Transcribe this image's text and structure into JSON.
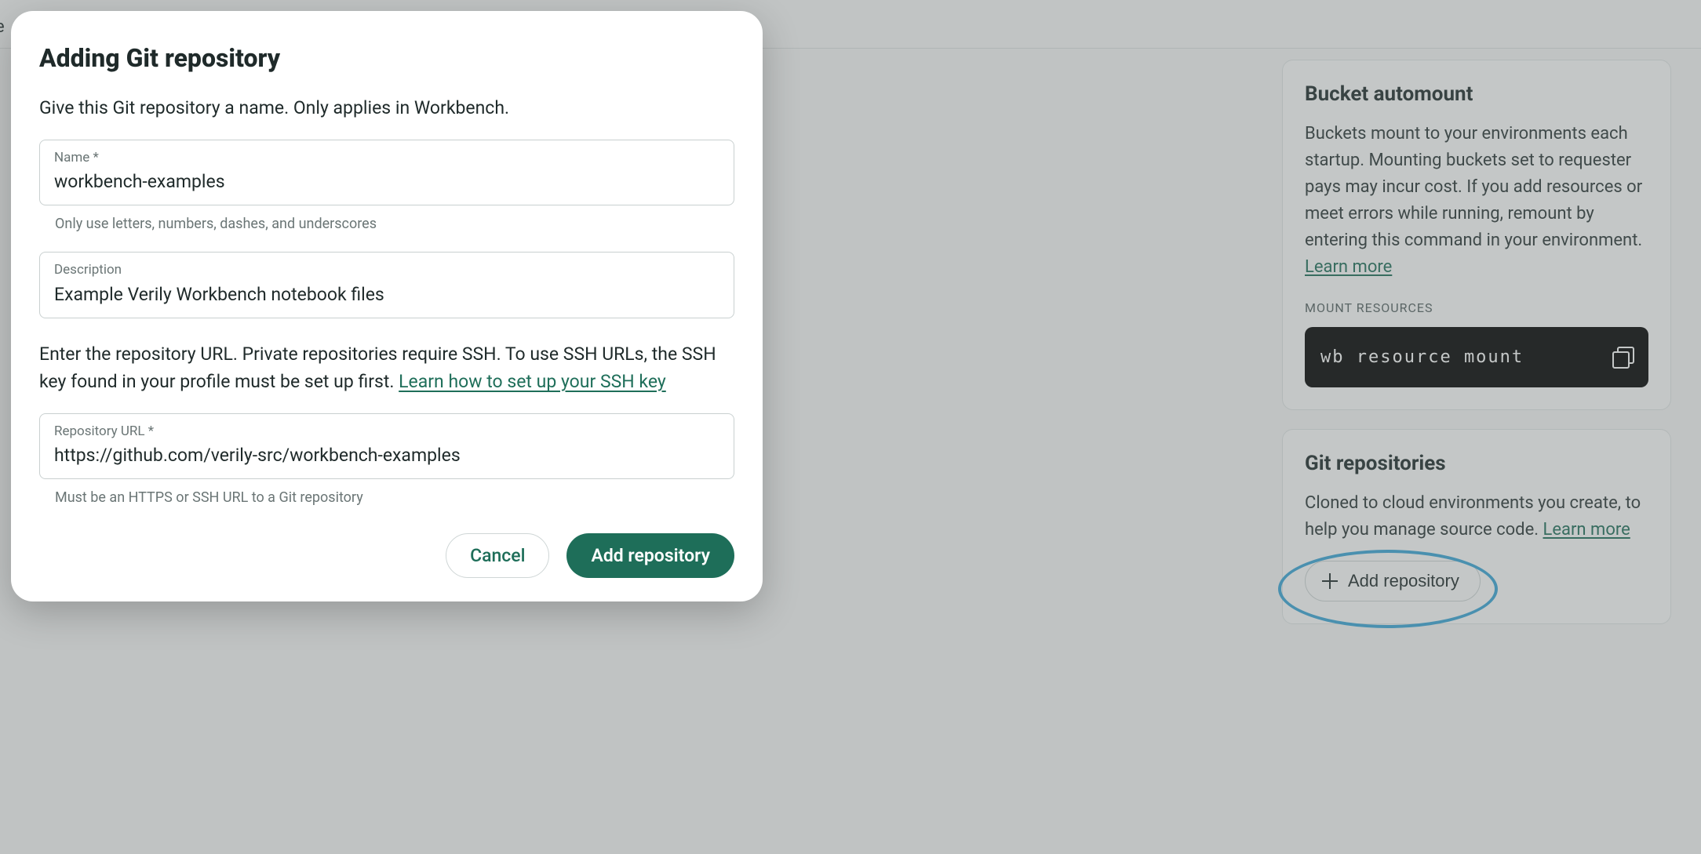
{
  "header": {
    "partial_text": "e"
  },
  "sidebar": {
    "bucket": {
      "title": "Bucket automount",
      "body": "Buckets mount to your environments each startup. Mounting buckets set to requester pays may incur cost. If you add resources or meet errors while running, remount by entering this command in your environment.",
      "learn_more": "Learn more",
      "mount_label": "MOUNT RESOURCES",
      "command": "wb resource mount"
    },
    "git": {
      "title": "Git repositories",
      "body": "Cloned to cloud environments you create, to help you manage source code.",
      "learn_more": "Learn more",
      "add_button": "Add repository"
    }
  },
  "modal": {
    "title": "Adding Git repository",
    "lead": "Give this Git repository a name. Only applies in Workbench.",
    "fields": {
      "name": {
        "label": "Name *",
        "value": "workbench-examples",
        "helper": "Only use letters, numbers, dashes, and underscores"
      },
      "description": {
        "label": "Description",
        "value": "Example Verily Workbench notebook files"
      },
      "url": {
        "label": "Repository URL *",
        "value": "https://github.com/verily-src/workbench-examples",
        "helper": "Must be an HTTPS or SSH URL to a Git repository"
      }
    },
    "url_section_text": "Enter the repository URL. Private repositories require SSH. To use SSH URLs, the SSH key found in your profile must be set up first.",
    "url_section_link": "Learn how to set up your SSH key",
    "actions": {
      "cancel": "Cancel",
      "submit": "Add repository"
    }
  }
}
